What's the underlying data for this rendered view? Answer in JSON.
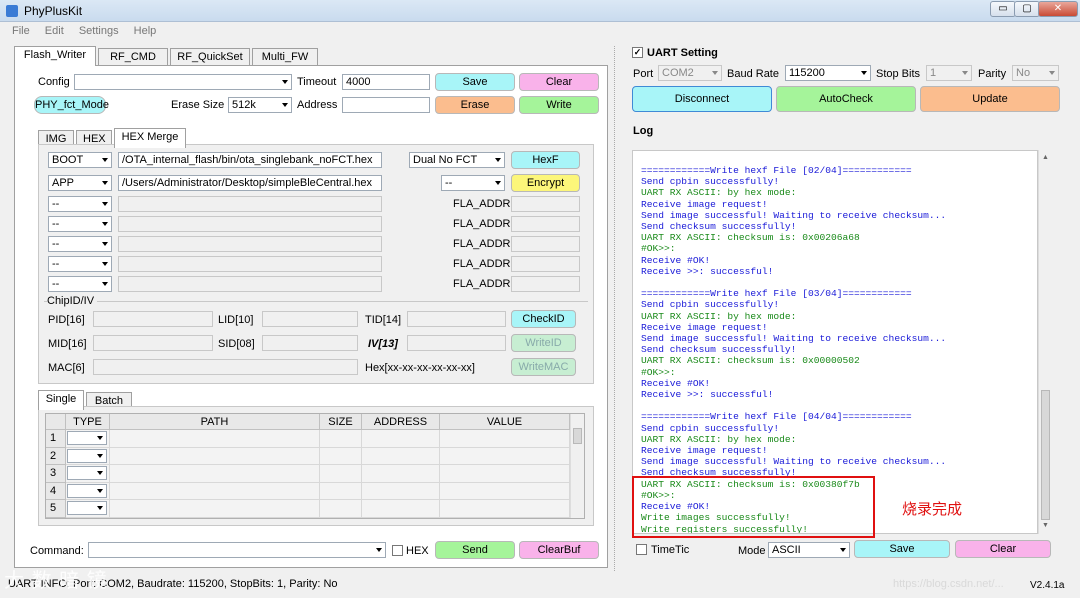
{
  "window": {
    "title": "PhyPlusKit",
    "min": "▭",
    "max": "▢",
    "close": "✕"
  },
  "menu": [
    "File",
    "Edit",
    "Settings",
    "Help"
  ],
  "main_tabs": [
    "Flash_Writer",
    "RF_CMD",
    "RF_QuickSet",
    "Multi_FW"
  ],
  "config": {
    "config_label": "Config",
    "config_value": "",
    "timeout_label": "Timeout",
    "timeout_value": "4000",
    "save": "Save",
    "clear": "Clear",
    "fct_mode": "PHY_fct_Mode",
    "erase_size_label": "Erase Size",
    "erase_size_value": "512k",
    "address_label": "Address",
    "address_value": "",
    "erase": "Erase",
    "write": "Write"
  },
  "sub_tabs": [
    "IMG",
    "HEX",
    "HEX Merge"
  ],
  "hex_merge": {
    "rows": [
      {
        "type": "BOOT",
        "path": "/OTA_internal_flash/bin/ota_singlebank_noFCT.hex",
        "opt": "Dual No FCT",
        "btn": "HexF"
      },
      {
        "type": "APP",
        "path": "/Users/Administrator/Desktop/simpleBleCentral.hex",
        "opt": "--",
        "btn": "Encrypt"
      },
      {
        "type": "--",
        "path": "",
        "fla": "FLA_ADDR"
      },
      {
        "type": "--",
        "path": "",
        "fla": "FLA_ADDR"
      },
      {
        "type": "--",
        "path": "",
        "fla": "FLA_ADDR"
      },
      {
        "type": "--",
        "path": "",
        "fla": "FLA_ADDR"
      },
      {
        "type": "--",
        "path": "",
        "fla": "FLA_ADDR"
      }
    ]
  },
  "chipid": {
    "group": "ChipID/IV",
    "pid": "PID[16]",
    "lid": "LID[10]",
    "tid": "TID[14]",
    "checkid": "CheckID",
    "mid": "MID[16]",
    "sid": "SID[08]",
    "iv": "IV[13]",
    "writeid": "WriteID",
    "mac": "MAC[6]",
    "hex_fmt": "Hex[xx-xx-xx-xx-xx-xx]",
    "writemac": "WriteMAC"
  },
  "batch_tabs": [
    "Single",
    "Batch"
  ],
  "table": {
    "headers": [
      "TYPE",
      "PATH",
      "SIZE",
      "ADDRESS",
      "VALUE"
    ],
    "rows": [
      "1",
      "2",
      "3",
      "4",
      "5"
    ]
  },
  "command": {
    "label": "Command:",
    "hex": "HEX",
    "send": "Send",
    "clearbuf": "ClearBuf"
  },
  "uart": {
    "title": "UART Setting",
    "port_label": "Port",
    "port": "COM2",
    "baud_label": "Baud Rate",
    "baud": "115200",
    "stop_label": "Stop Bits",
    "stop": "1",
    "parity_label": "Parity",
    "parity": "No",
    "disconnect": "Disconnect",
    "autocheck": "AutoCheck",
    "update": "Update"
  },
  "log": {
    "title": "Log",
    "lines": [
      {
        "t": "============Write hexf File [02/04]============",
        "c": "blue"
      },
      {
        "t": "Send cpbin successfully!",
        "c": "blue"
      },
      {
        "t": "UART RX ASCII: by hex mode:",
        "c": "green"
      },
      {
        "t": "Receive image request!",
        "c": "blue"
      },
      {
        "t": "Send image successful! Waiting to receive checksum...",
        "c": "blue"
      },
      {
        "t": "Send checksum successfully!",
        "c": "blue"
      },
      {
        "t": "UART RX ASCII: checksum is: 0x00206a68",
        "c": "green"
      },
      {
        "t": "#OK>>:",
        "c": "green"
      },
      {
        "t": "Receive #OK!",
        "c": "blue"
      },
      {
        "t": "Receive >>: successful!",
        "c": "blue"
      },
      {
        "t": "",
        "c": "blue"
      },
      {
        "t": "============Write hexf File [03/04]============",
        "c": "blue"
      },
      {
        "t": "Send cpbin successfully!",
        "c": "blue"
      },
      {
        "t": "UART RX ASCII: by hex mode:",
        "c": "green"
      },
      {
        "t": "Receive image request!",
        "c": "blue"
      },
      {
        "t": "Send image successful! Waiting to receive checksum...",
        "c": "blue"
      },
      {
        "t": "Send checksum successfully!",
        "c": "blue"
      },
      {
        "t": "UART RX ASCII: checksum is: 0x00000502",
        "c": "green"
      },
      {
        "t": "#OK>>:",
        "c": "green"
      },
      {
        "t": "Receive #OK!",
        "c": "blue"
      },
      {
        "t": "Receive >>: successful!",
        "c": "blue"
      },
      {
        "t": "",
        "c": "blue"
      },
      {
        "t": "============Write hexf File [04/04]============",
        "c": "blue"
      },
      {
        "t": "Send cpbin successfully!",
        "c": "blue"
      },
      {
        "t": "UART RX ASCII: by hex mode:",
        "c": "green"
      },
      {
        "t": "Receive image request!",
        "c": "blue"
      },
      {
        "t": "Send image successful! Waiting to receive checksum...",
        "c": "blue"
      },
      {
        "t": "Send checksum successfully!",
        "c": "blue"
      },
      {
        "t": "UART RX ASCII: checksum is: 0x00380f7b",
        "c": "green"
      },
      {
        "t": "#OK>>:",
        "c": "green"
      },
      {
        "t": "Receive #OK!",
        "c": "blue"
      },
      {
        "t": "Write images successfully!",
        "c": "green"
      },
      {
        "t": "Write registers successfully!",
        "c": "green"
      }
    ],
    "annotation": "烧录完成"
  },
  "bottom": {
    "timetic": "TimeTic",
    "mode_label": "Mode",
    "mode": "ASCII",
    "save": "Save",
    "clear": "Clear"
  },
  "status": {
    "text": "UART INFO: Port: COM2, Baudrate: 115200, StopBits: 1, Parity: No",
    "version": "V2.4.1a",
    "watermark_left": "大 数 暗 镜",
    "watermark_right": "https://blog.csdn.net/..."
  },
  "colors": {
    "log_blue": "#1a1ad8",
    "log_green": "#1a8a1a",
    "highlight": "#e01010"
  }
}
